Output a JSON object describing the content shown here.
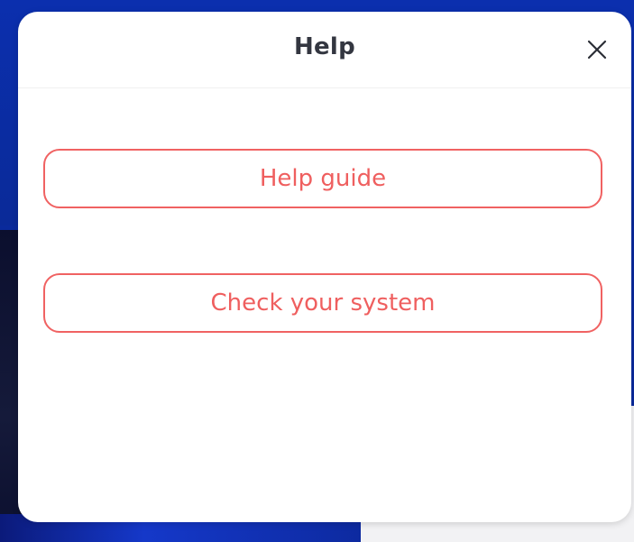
{
  "dialog": {
    "title": "Help",
    "close_icon": "close-icon"
  },
  "actions": [
    {
      "label": "Help guide"
    },
    {
      "label": "Check your system"
    }
  ],
  "colors": {
    "accent": "#ef5f5f",
    "title_text": "#333640",
    "backdrop": "#0a2a9c",
    "dialog_bg": "#ffffff"
  }
}
